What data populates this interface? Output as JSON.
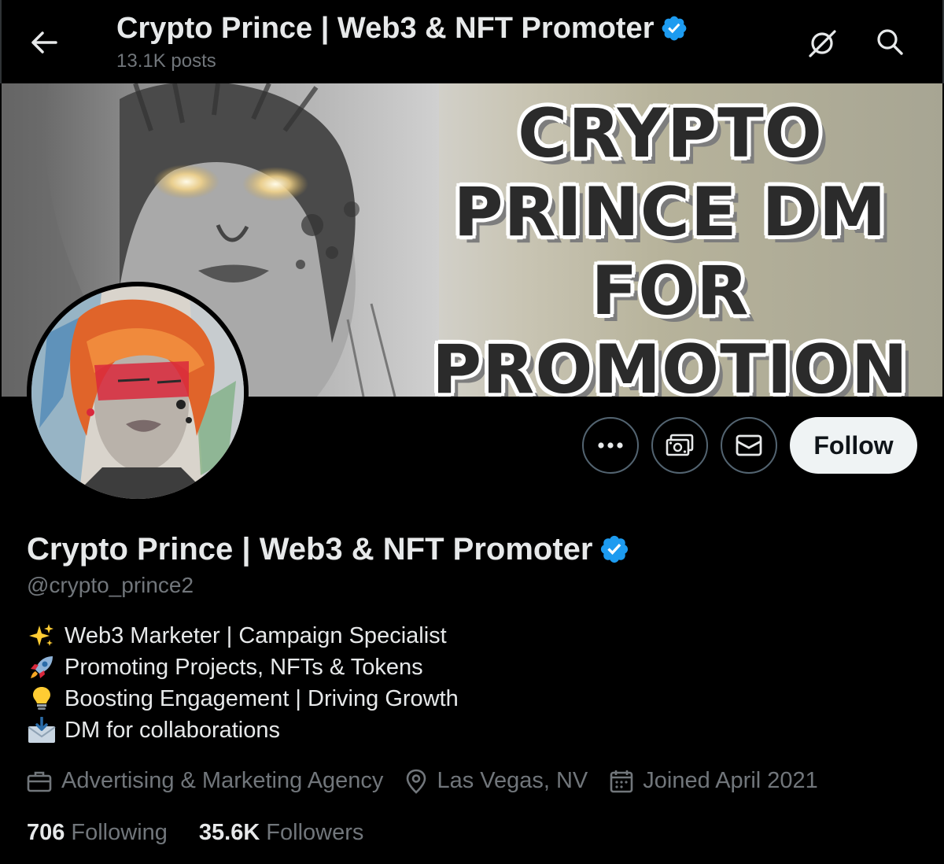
{
  "header": {
    "title": "Crypto Prince | Web3 & NFT Promoter",
    "posts_count": "13.1K posts"
  },
  "banner": {
    "lines": [
      "CRYPTO",
      "PRINCE DM",
      "FOR",
      "PROMOTION"
    ]
  },
  "actions": {
    "follow_label": "Follow"
  },
  "profile": {
    "name": "Crypto Prince | Web3 & NFT Promoter",
    "handle": "@crypto_prince2",
    "bio": [
      {
        "emoji": "sparkles-icon",
        "text": "Web3 Marketer | Campaign Specialist"
      },
      {
        "emoji": "rocket-icon",
        "text": "Promoting Projects, NFTs & Tokens"
      },
      {
        "emoji": "lightbulb-icon",
        "text": "Boosting Engagement | Driving Growth"
      },
      {
        "emoji": "inbox-envelope-icon",
        "text": "DM for collaborations"
      }
    ],
    "category": "Advertising & Marketing Agency",
    "location": "Las Vegas, NV",
    "joined": "Joined April 2021"
  },
  "stats": {
    "following_count": "706",
    "following_label": "Following",
    "followers_count": "35.6K",
    "followers_label": "Followers"
  },
  "colors": {
    "background": "#000000",
    "verified_badge": "#1d9bf0",
    "muted_text": "#71767b",
    "follow_button_bg": "#eff3f4"
  }
}
